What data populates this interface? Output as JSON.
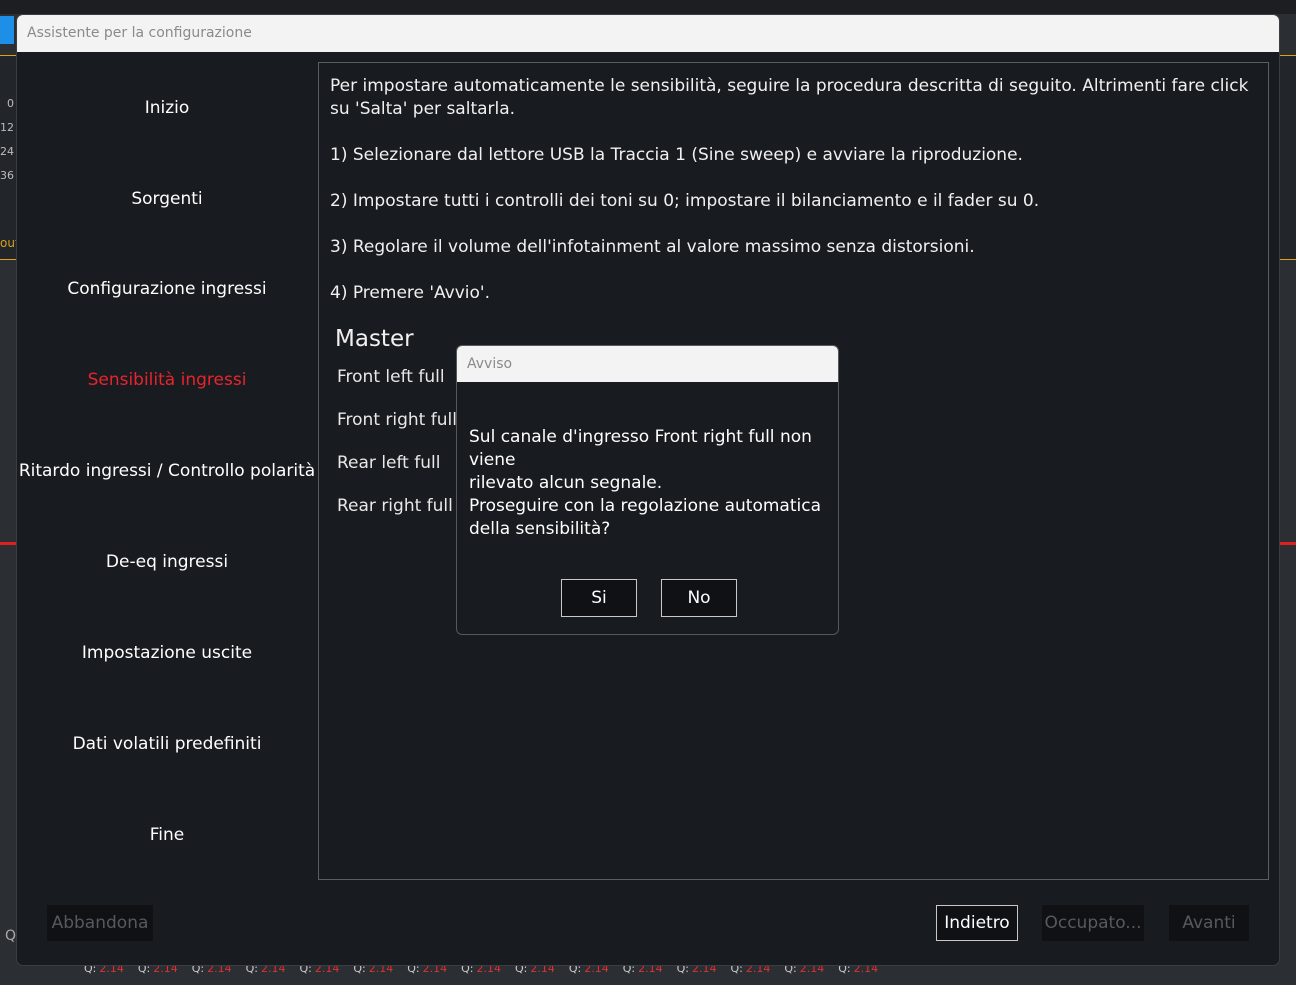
{
  "wizard": {
    "title": "Assistente per la configurazione",
    "nav": [
      {
        "label": "Inizio",
        "active": false
      },
      {
        "label": "Sorgenti",
        "active": false
      },
      {
        "label": "Configurazione ingressi",
        "active": false
      },
      {
        "label": "Sensibilità ingressi",
        "active": true
      },
      {
        "label": "Ritardo ingressi / Controllo polarità",
        "active": false
      },
      {
        "label": "De-eq ingressi",
        "active": false
      },
      {
        "label": "Impostazione uscite",
        "active": false
      },
      {
        "label": "Dati volatili predefiniti",
        "active": false
      },
      {
        "label": "Fine",
        "active": false
      }
    ],
    "instructions": [
      "Per impostare automaticamente le sensibilità, seguire la procedura descritta di seguito. Altrimenti fare click su 'Salta' per saltarla.",
      "1) Selezionare dal lettore USB la Traccia 1 (Sine sweep) e avviare la riproduzione.",
      "2) Impostare tutti i controlli dei toni su 0; impostare il bilanciamento e il fader su 0.",
      "3) Regolare il volume dell'infotainment al valore massimo senza distorsioni.",
      "4) Premere 'Avvio'."
    ],
    "master": {
      "title": "Master",
      "channels": [
        "Front left full",
        "Front right full",
        "Rear left full",
        "Rear right full"
      ]
    },
    "footer": {
      "abort": "Abbandona",
      "back": "Indietro",
      "busy": "Occupato...",
      "next": "Avanti"
    }
  },
  "dialog": {
    "title": "Avviso",
    "message_lines": [
      "Sul canale d'ingresso Front right full non viene",
      "rilevato alcun segnale.",
      "Proseguire con la regolazione automatica",
      "della sensibilità?"
    ],
    "yes": "Si",
    "no": "No"
  },
  "background": {
    "ticks": [
      "0",
      "12",
      "24",
      "36"
    ],
    "out_label": "out",
    "q_left": "Q",
    "bottom_strip": {
      "q_label": "Q:",
      "q_value": "2.14",
      "count": 15
    }
  }
}
